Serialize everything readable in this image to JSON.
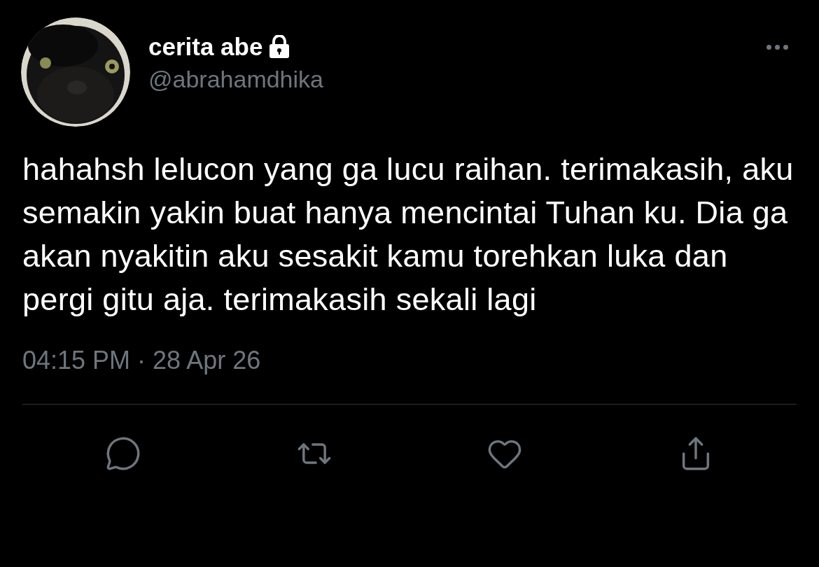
{
  "author": {
    "name": "cerita abe",
    "protected": true,
    "handle": "@abrahamdhika"
  },
  "tweet": {
    "text": "hahahsh lelucon yang ga lucu raihan. terimakasih, aku semakin yakin buat hanya mencintai Tuhan ku. Dia ga akan nyakitin aku sesakit kamu torehkan luka dan pergi gitu aja. terimakasih sekali lagi",
    "timestamp": "04:15 PM · 28 Apr 26"
  },
  "actions": [
    {
      "kind": "reply"
    },
    {
      "kind": "retweet"
    },
    {
      "kind": "like"
    },
    {
      "kind": "share"
    }
  ]
}
